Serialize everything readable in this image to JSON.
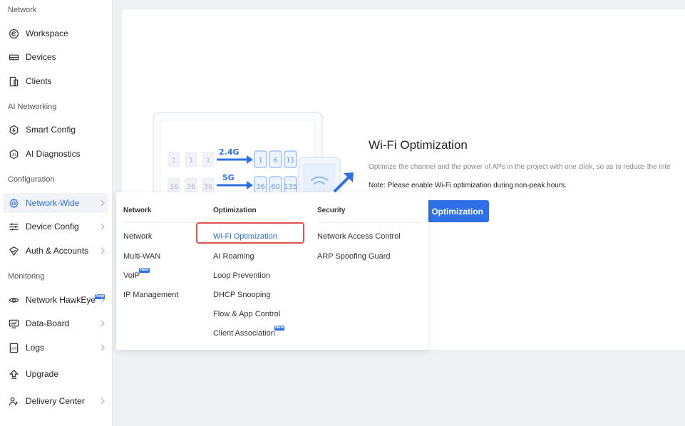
{
  "sidebar": {
    "sections": {
      "network": "Network",
      "ai": "AI Networking",
      "config": "Configuration",
      "monitoring": "Monitoring"
    },
    "items": {
      "workspace": "Workspace",
      "devices": "Devices",
      "clients": "Clients",
      "smart_config": "Smart Config",
      "ai_diagnostics": "AI Diagnostics",
      "network_wide": "Network-Wide",
      "device_config": "Device Config",
      "auth_accounts": "Auth & Accounts",
      "network_hawkeye": "Network HawkEye",
      "data_board": "Data-Board",
      "logs": "Logs",
      "upgrade": "Upgrade",
      "delivery_center": "Delivery Center"
    },
    "new_badge": "New",
    "active_color": "#2f6fe8"
  },
  "main": {
    "title": "Wi-Fi Optimization",
    "description": "Optimize the channel and the power of APs in the project with one click, so as to reduce the inte",
    "note": "Note: Please enable Wi-Fi optimization during non-peak hours.",
    "button": "Optimization",
    "illustration": {
      "band1": "2.4G",
      "band2": "5G",
      "row1_left": [
        "1",
        "1",
        "1"
      ],
      "row1_right": [
        "1",
        "6",
        "11"
      ],
      "row2_left": [
        "36",
        "36",
        "36"
      ],
      "row2_right": [
        "36",
        "60",
        "135"
      ]
    }
  },
  "dropdown": {
    "columns": {
      "network": {
        "header": "Network",
        "items": [
          "Network",
          "Multi-WAN",
          "VoIP",
          "IP Management"
        ]
      },
      "optimization": {
        "header": "Optimization",
        "items": [
          "Wi-Fi Optimization",
          "AI Roaming",
          "Loop Prevention",
          "DHCP Snooping",
          "Flow & App Control",
          "Client Association"
        ]
      },
      "security": {
        "header": "Security",
        "items": [
          "Network Access Control",
          "ARP Spoofing Guard"
        ]
      }
    },
    "highlight_color": "#e0534a"
  }
}
